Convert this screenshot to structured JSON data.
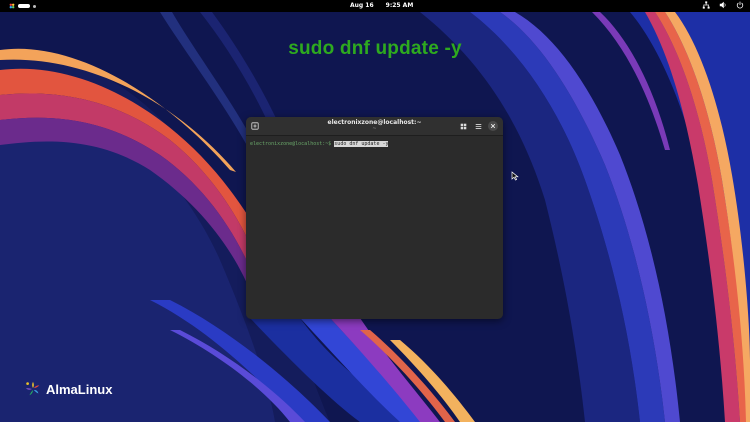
{
  "topbar": {
    "date": "Aug 16",
    "time": "9:25 AM"
  },
  "headline": "sudo dnf update -y",
  "terminal": {
    "title": "electronixzone@localhost:~",
    "subtitle": "~",
    "prompt": "electronixzone@localhost:~$ ",
    "command": "sudo dnf update -y"
  },
  "brand": {
    "name": "AlmaLinux"
  },
  "colors": {
    "headline": "#2eaa1f",
    "terminal_bg": "#2b2b2b",
    "wallpaper_base": "#0f1650"
  },
  "icons": [
    "almalinux-logo-icon",
    "activities-pill-icon",
    "network-icon",
    "volume-icon",
    "power-icon",
    "new-tab-icon",
    "grid-view-icon",
    "menu-icon",
    "close-icon",
    "mouse-cursor-icon"
  ]
}
